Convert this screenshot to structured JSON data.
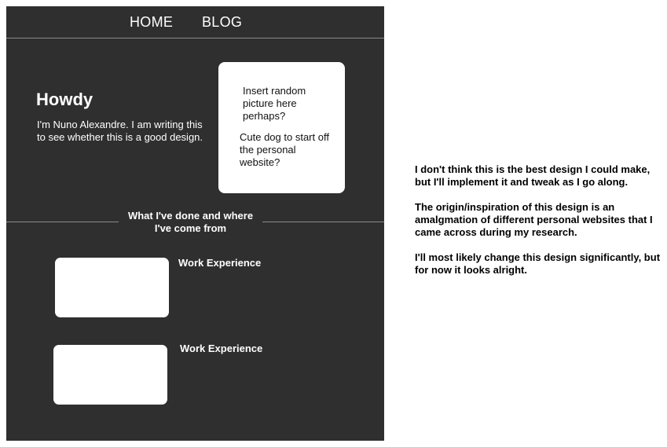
{
  "nav": {
    "home_label": "HOME",
    "blog_label": "BLOG"
  },
  "hero": {
    "heading": "Howdy",
    "intro": "I'm Nuno Alexandre. I am writing this to see whether this is a good design."
  },
  "photo_placeholder": {
    "note_1": "Insert random picture here perhaps?",
    "note_2": "Cute dog to start off the personal website?"
  },
  "experience": {
    "heading": "What I've done and where I've come from",
    "items": [
      {
        "label": "Work Experience"
      },
      {
        "label": "Work Experience"
      }
    ]
  },
  "notes": {
    "paragraphs": [
      "I don't think this is the best design I could make, but I'll implement it and tweak as I go along.",
      "The origin/inspiration of this design is an amalgmation of different personal websites that I came across during my research.",
      "I'll most likely change this design significantly, but for now it looks alright."
    ]
  },
  "colors": {
    "mockup_background": "#2f2f2f",
    "card_background": "#ffffff",
    "divider": "#8a8a8a"
  }
}
